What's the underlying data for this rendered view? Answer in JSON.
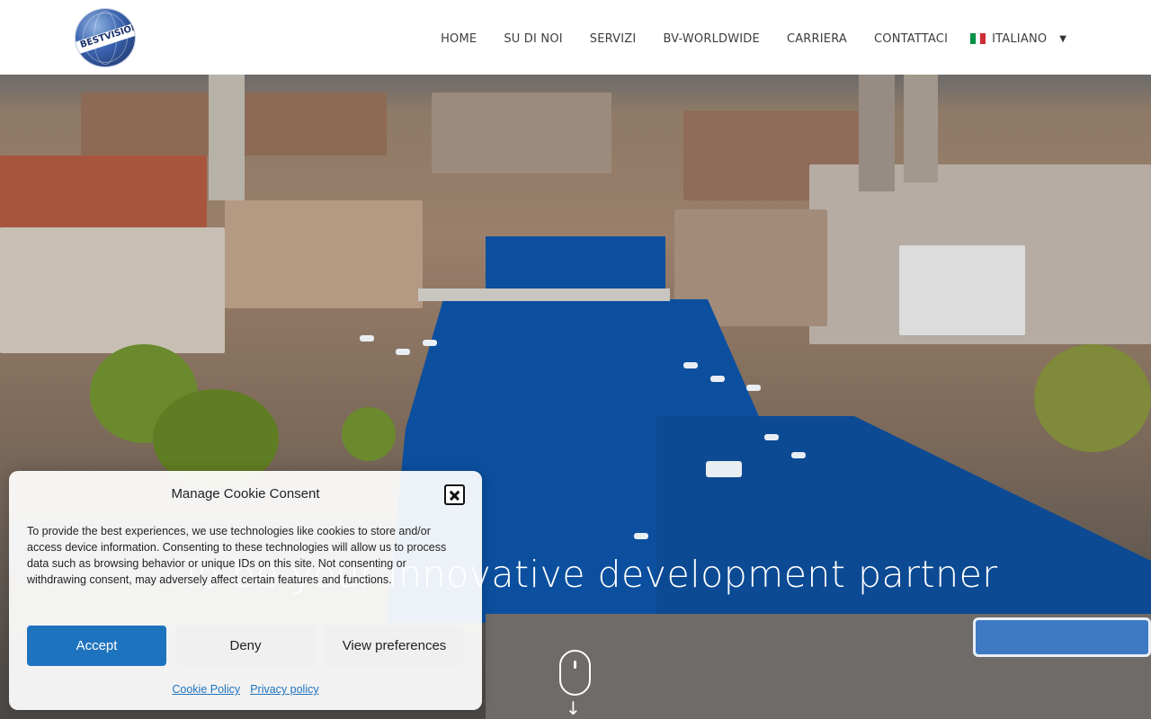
{
  "header": {
    "logo_text": "BESTVISION",
    "nav": [
      {
        "label": "HOME"
      },
      {
        "label": "SU DI NOI"
      },
      {
        "label": "SERVIZI"
      },
      {
        "label": "BV-WORLDWIDE"
      },
      {
        "label": "CARRIERA"
      },
      {
        "label": "CONTATTACI"
      }
    ],
    "language": {
      "label": "ITALIANO",
      "flag_icon": "italy-flag-icon",
      "flag_colors": [
        "#009246",
        "#ffffff",
        "#ce2b37"
      ]
    }
  },
  "hero": {
    "headline": "To be your innovative development partner",
    "scroll_icon": "mouse-scroll-icon"
  },
  "cookie_banner": {
    "title": "Manage Cookie Consent",
    "body": "To provide the best experiences, we use technologies like cookies to store and/or access device information. Consenting to these technologies will allow us to process data such as browsing behavior or unique IDs on this site. Not consenting or withdrawing consent, may adversely affect certain features and functions.",
    "accept_label": "Accept",
    "deny_label": "Deny",
    "preferences_label": "View preferences",
    "cookie_policy_label": "Cookie Policy",
    "privacy_policy_label": "Privacy policy",
    "accent_color": "#1e73be"
  }
}
